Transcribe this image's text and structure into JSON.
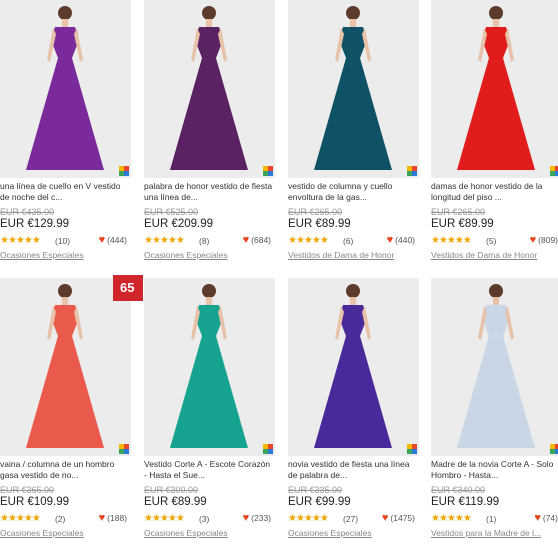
{
  "products": [
    {
      "title": "una línea de cuello en V vestido de noche del c...",
      "old_price": "EUR €435.00",
      "price": "EUR €129.99",
      "reviews": "(10)",
      "favorites": "(444)",
      "category": "Ocasiones Especiales",
      "dress_color": "#7a2a9a"
    },
    {
      "title": "palabra de honor vestido de fiesta una línea de...",
      "old_price": "EUR €525.00",
      "price": "EUR €209.99",
      "reviews": "(8)",
      "favorites": "(684)",
      "category": "Ocasiones Especiales",
      "dress_color": "#5b2263"
    },
    {
      "title": "vestido de columna y cuello envoltura de la gas...",
      "old_price": "EUR €265.00",
      "price": "EUR €89.99",
      "reviews": "(6)",
      "favorites": "(440)",
      "category": "Vestidos de Dama de Honor",
      "dress_color": "#0f5266"
    },
    {
      "title": "damas de honor vestido de la longitud del piso ...",
      "old_price": "EUR €265.00",
      "price": "EUR €89.99",
      "reviews": "(5)",
      "favorites": "(809)",
      "category": "Vestidos de Dama de Honor",
      "dress_color": "#e01c1c"
    },
    {
      "title": "vaina / columna de un hombro gasa vestido de no...",
      "old_price": "EUR €365.00",
      "price": "EUR €109.99",
      "reviews": "(2)",
      "favorites": "(188)",
      "category": "Ocasiones Especiales",
      "dress_color": "#ea5a4c"
    },
    {
      "title": "Vestido Corte A - Escote Corazón - Hasta el Sue...",
      "old_price": "EUR €300.00",
      "price": "EUR €89.99",
      "reviews": "(3)",
      "favorites": "(233)",
      "category": "Ocasiones Especiales",
      "dress_color": "#16a38f"
    },
    {
      "title": "novia vestido de fiesta una línea de palabra de...",
      "old_price": "EUR €335.00",
      "price": "EUR €99.99",
      "reviews": "(27)",
      "favorites": "(1475)",
      "category": "Ocasiones Especiales",
      "dress_color": "#4a2a9a"
    },
    {
      "title": "Madre de la novia Corte A - Solo Hombro - Hasta...",
      "old_price": "EUR €340.00",
      "price": "EUR €119.99",
      "reviews": "(1)",
      "favorites": "(74)",
      "category": "Vestidos para la Madre de l...",
      "dress_color": "#c9d6e6"
    }
  ],
  "sale_badge": "65",
  "stars": "★★★★★",
  "heart": "♥"
}
